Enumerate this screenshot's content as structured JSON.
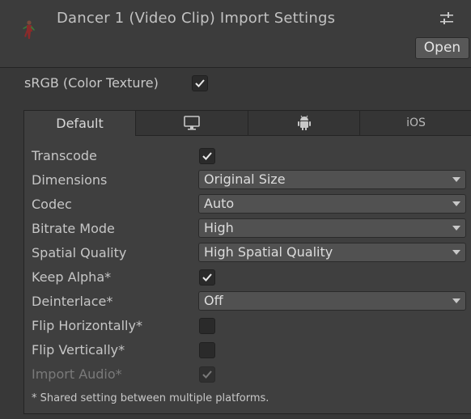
{
  "header": {
    "title": "Dancer 1 (Video Clip) Import Settings",
    "settings_icon": "sliders-icon",
    "open_label": "Open"
  },
  "srgb": {
    "label": "sRGB (Color Texture)",
    "checked": true
  },
  "tabs": [
    {
      "label": "Default",
      "icon": null,
      "active": true
    },
    {
      "label": "",
      "icon": "monitor-icon",
      "active": false
    },
    {
      "label": "",
      "icon": "android-icon",
      "active": false
    },
    {
      "label": "iOS",
      "icon": null,
      "active": false
    }
  ],
  "rows": {
    "transcode": {
      "label": "Transcode",
      "checked": true
    },
    "dimensions": {
      "label": "Dimensions",
      "value": "Original Size"
    },
    "codec": {
      "label": "Codec",
      "value": "Auto"
    },
    "bitrate_mode": {
      "label": "Bitrate Mode",
      "value": "High"
    },
    "spatial_quality": {
      "label": "Spatial Quality",
      "value": "High Spatial Quality"
    },
    "keep_alpha": {
      "label": "Keep Alpha*",
      "checked": true
    },
    "deinterlace": {
      "label": "Deinterlace*",
      "value": "Off"
    },
    "flip_horizontally": {
      "label": "Flip Horizontally*",
      "checked": false
    },
    "flip_vertically": {
      "label": "Flip Vertically*",
      "checked": false
    },
    "import_audio": {
      "label": "Import Audio*",
      "checked": true,
      "disabled": true
    }
  },
  "footnote": "* Shared setting between multiple platforms.",
  "colors": {
    "background": "#383838",
    "panel": "#3f3f3f",
    "dropdown": "#515151",
    "text": "#c6c6c6"
  }
}
